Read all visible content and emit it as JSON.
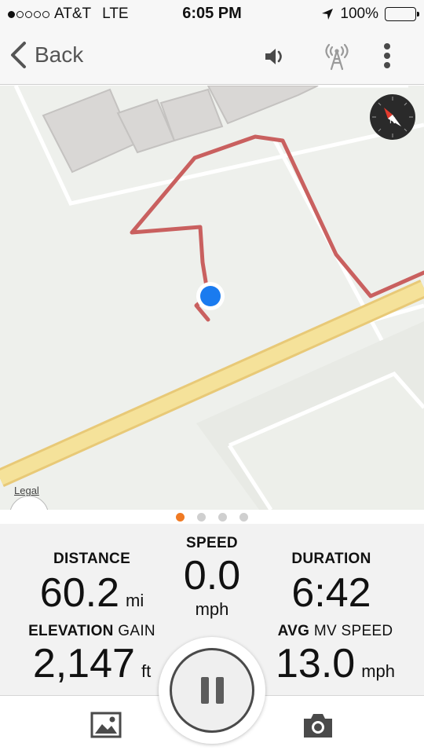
{
  "status_bar": {
    "carrier": "AT&T",
    "network": "LTE",
    "time": "6:05 PM",
    "battery": "100%",
    "signal_bars_filled": 1,
    "signal_bars_total": 5
  },
  "nav": {
    "back_label": "Back",
    "icons": [
      "chevron-left-icon",
      "speaker-icon",
      "broadcast-tower-icon",
      "more-vertical-icon"
    ]
  },
  "map": {
    "legal_label": "Legal",
    "icons": [
      "compass-icon",
      "layers-icon",
      "current-location-marker"
    ],
    "colors": {
      "route": "#c9605f",
      "location": "#1a7bef",
      "highway": "#f3df8f",
      "land": "#eef0ec"
    }
  },
  "pager": {
    "active_index": 0,
    "count": 4,
    "active_color": "#f07a23"
  },
  "stats": {
    "distance": {
      "label": "DISTANCE",
      "value": "60.2",
      "unit": "mi"
    },
    "speed": {
      "label": "SPEED",
      "value": "0.0",
      "unit": "mph"
    },
    "duration": {
      "label": "DURATION",
      "value": "6:42"
    },
    "elevation": {
      "label_main": "ELEVATION",
      "label_sub": "GAIN",
      "value": "2,147",
      "unit": "ft"
    },
    "avg_speed": {
      "label_main": "AVG",
      "label_sub": "MV SPEED",
      "value": "13.0",
      "unit": "mph"
    }
  },
  "toolbar": {
    "icons": [
      "photo-gallery-icon",
      "pause-icon",
      "camera-icon"
    ]
  }
}
